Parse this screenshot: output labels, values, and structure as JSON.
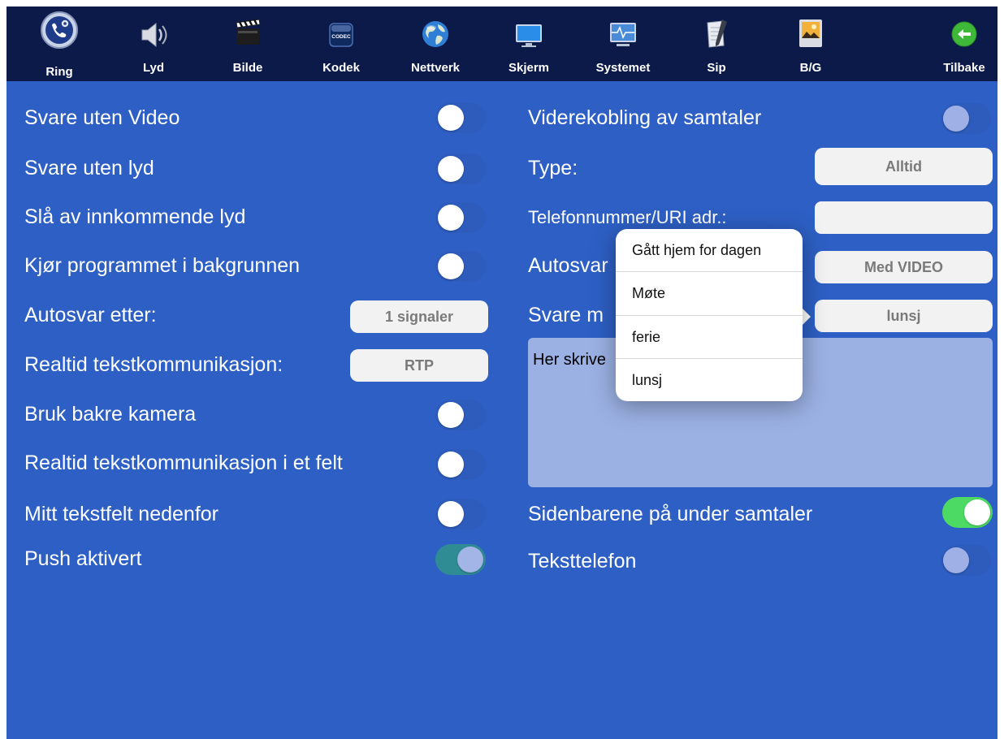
{
  "toolbar": {
    "items": [
      {
        "label": "Ring",
        "icon": "phone-gear-icon"
      },
      {
        "label": "Lyd",
        "icon": "speaker-icon"
      },
      {
        "label": "Bilde",
        "icon": "clapperboard-icon"
      },
      {
        "label": "Kodek",
        "icon": "codec-chip-icon"
      },
      {
        "label": "Nettverk",
        "icon": "globe-icon"
      },
      {
        "label": "Skjerm",
        "icon": "monitor-icon"
      },
      {
        "label": "Systemet",
        "icon": "system-monitor-icon"
      },
      {
        "label": "Sip",
        "icon": "notepad-icon"
      },
      {
        "label": "B/G",
        "icon": "picture-icon"
      },
      {
        "label": "Tilbake",
        "icon": "back-arrow-icon"
      }
    ],
    "icon_codec_text": "CODEC"
  },
  "left_settings": {
    "answer_without_video": {
      "label": "Svare uten Video",
      "enabled": false
    },
    "answer_without_audio": {
      "label": "Svare uten lyd",
      "enabled": false
    },
    "mute_incoming_audio": {
      "label": "Slå av innkommende lyd",
      "enabled": false
    },
    "run_in_background": {
      "label": "Kjør programmet i bakgrunnen",
      "enabled": false
    },
    "autoanswer_after": {
      "label": "Autosvar etter:",
      "value": "1 signaler"
    },
    "realtime_text": {
      "label": "Realtid tekstkommunikasjon:",
      "value": "RTP"
    },
    "use_back_camera": {
      "label": "Bruk bakre kamera",
      "enabled": false
    },
    "realtime_text_single_field": {
      "label": "Realtid tekstkommunikasjon i et felt",
      "enabled": false
    },
    "my_textfield_below": {
      "label": "Mitt tekstfelt nedenfor",
      "enabled": false
    },
    "push_enabled": {
      "label": "Push aktivert",
      "enabled": true
    }
  },
  "right_settings": {
    "call_forwarding": {
      "label": "Viderekobling av samtaler",
      "enabled": false
    },
    "type": {
      "label": "Type:",
      "value": "Alltid"
    },
    "phone_uri": {
      "label": "Telefonnummer/URI adr.:",
      "value": ""
    },
    "autoanswer": {
      "label": "Autosvar",
      "value": "Med VIDEO"
    },
    "answer_with": {
      "label": "Svare m",
      "value": "lunsj"
    },
    "message_text": "Her skrive",
    "sidebars_during_calls": {
      "label": "Sidenbarene på under samtaler",
      "enabled": true
    },
    "text_telephone": {
      "label": "Teksttelefon",
      "enabled": false
    }
  },
  "popover": {
    "options": [
      "Gått hjem for dagen",
      "Møte",
      "ferie",
      "lunsj"
    ]
  },
  "colors": {
    "background": "#2d5fc4",
    "toolbar": "#0c1a4a",
    "toggle_on_green": "#4cd964",
    "toggle_on_teal": "#2f8c94"
  }
}
